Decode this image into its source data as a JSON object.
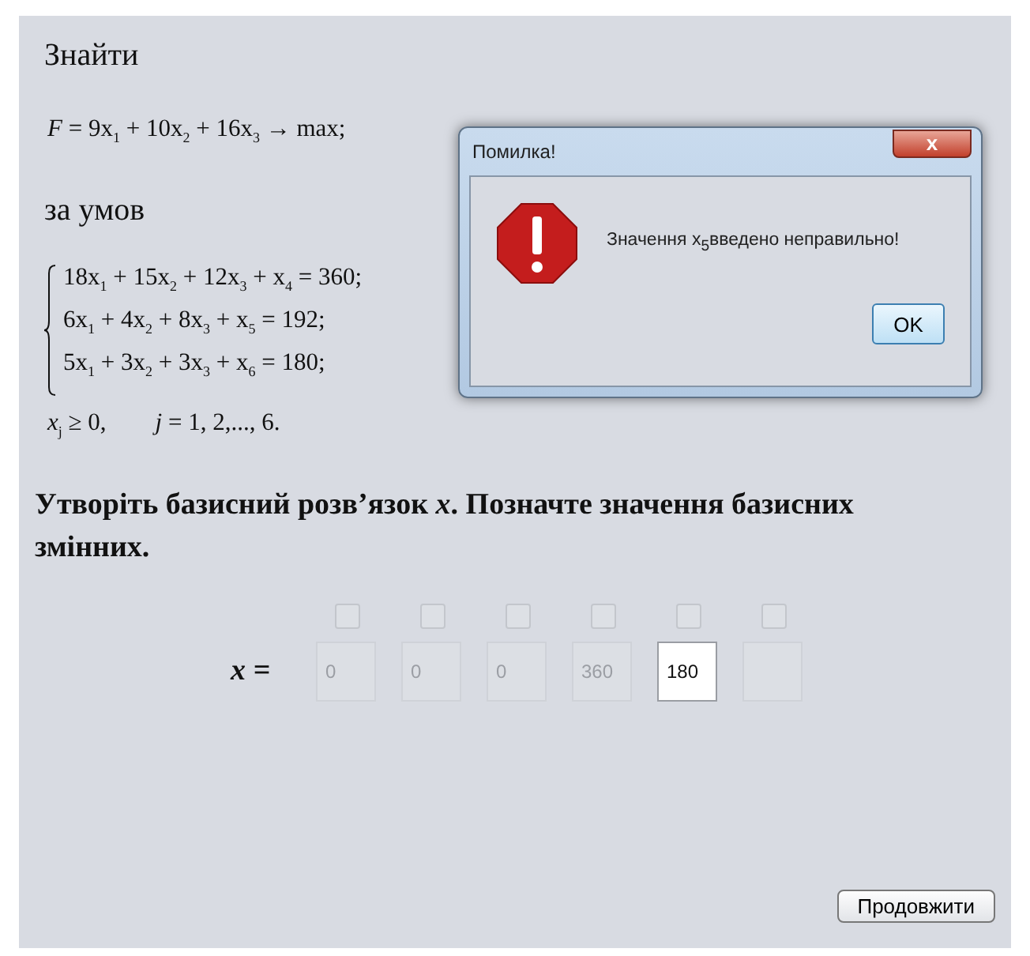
{
  "heading": "Знайти",
  "objective": "*F* = 9x$_{1}$ + 10x$_{2}$ + 16x$_{3}$ → max;",
  "conditions_label": "за умов",
  "constraints": [
    "18x$_{1}$ + 15x$_{2}$ + 12x$_{3}$ + x$_{4}$ = 360;",
    "6x$_{1}$ + 4x$_{2}$ + 8x$_{3}$ + x$_{5}$ = 192;",
    "5x$_{1}$ + 3x$_{2}$ + 3x$_{3}$ + x$_{6}$ = 180;"
  ],
  "nonnegativity": "*x*$_{j}$ ≥ 0,        *j* = 1, 2,..., 6.",
  "task": "Утворіть базисний розв’язок *x*. Позначте значення базисних змінних.",
  "vector_label": "x =",
  "components": [
    {
      "checked": false,
      "value": "0",
      "disabled": true
    },
    {
      "checked": false,
      "value": "0",
      "disabled": true
    },
    {
      "checked": false,
      "value": "0",
      "disabled": true
    },
    {
      "checked": false,
      "value": "360",
      "disabled": true
    },
    {
      "checked": false,
      "value": "180",
      "disabled": false
    },
    {
      "checked": false,
      "disabled": true
    }
  ],
  "continue_button": "Продовжити",
  "dialog": {
    "title": "Помилка!",
    "close": "x",
    "message": "Значення x$_{5}$введено неправильно!",
    "ok": "OK"
  }
}
